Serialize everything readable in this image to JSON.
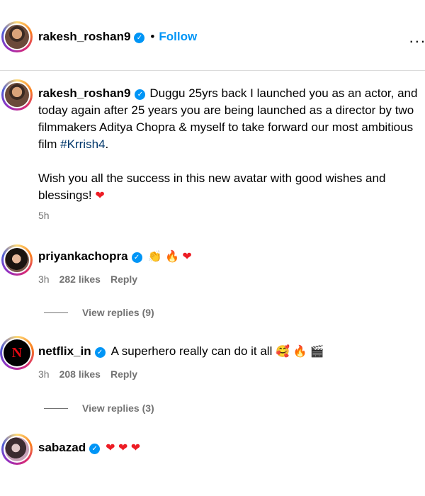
{
  "header": {
    "username": "rakesh_roshan9",
    "follow_label": "Follow",
    "separator": "•",
    "more": "..."
  },
  "post": {
    "username": "rakesh_roshan9",
    "text_before_tag": "Duggu 25yrs back I launched you as an actor, and today again after 25 years you are being launched as a director by two filmmakers Aditya Chopra & myself to take forward our most ambitious film ",
    "hashtag": "#Krrish4",
    "text_after_tag": ".",
    "para2": "Wish you all the success in this new avatar with good wishes and blessings!",
    "para2_emoji": "❤",
    "time": "5h"
  },
  "comments": [
    {
      "username": "priyankachopra",
      "text": "",
      "emojis": "👏 🔥 ❤",
      "time": "3h",
      "likes": "282 likes",
      "reply": "Reply",
      "view_replies": "View replies (9)"
    },
    {
      "username": "netflix_in",
      "text": "A superhero really can do it all",
      "emojis": "🥰 🔥 🎬",
      "time": "3h",
      "likes": "208 likes",
      "reply": "Reply",
      "view_replies": "View replies (3)",
      "avatar_letter": "N"
    },
    {
      "username": "sabazad",
      "text": "",
      "emojis": "❤ ❤ ❤"
    }
  ],
  "colors": {
    "accent": "#0095f6",
    "heart": "#ed1c24",
    "hashtag": "#00376b",
    "muted": "#737373"
  }
}
